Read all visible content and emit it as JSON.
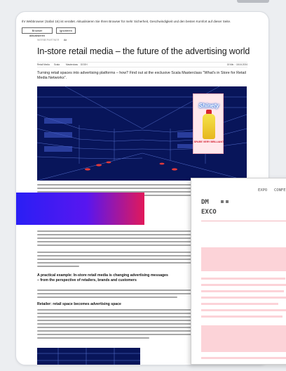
{
  "browser_warning": {
    "text": "Ihr Webbrowser (Safari 16) ist veraltet. Aktualisieren Sie Ihren Browser für mehr Sicherheit, Geschwindigkeit und den besten Komfort auf dieser Seite.",
    "update_button": "Browser aktualisieren",
    "ignore_button": "Ignorieren"
  },
  "article": {
    "category": "WERBEPARTNER",
    "ad_label": "Ad",
    "title": "In-store retail media – the future of the advertising world",
    "tags": [
      "Retail Media",
      "Scala",
      "Masterclass",
      "DOOH"
    ],
    "reading_time": "15 Min. · 18.04.2024",
    "lead": "Turning retail spaces into advertising platforms – how? Find out at the exclusive Scala Masterclass \"What's in Store for Retail Media Networks\".",
    "section_heading": "A practical example: In-store retail media is changing advertising messages – from the perspective of retailers, brands and customers",
    "subsection_heading": "Retailer: retail space becomes advertising space"
  },
  "hero_ad": {
    "brand": "Shinety",
    "offer": "SPARE VERY BRILLIANT"
  },
  "overlay": {
    "nav": [
      "EXPO",
      "CONFE"
    ],
    "logo_line1": "DM",
    "logo_line2": "EXCO"
  },
  "colors": {
    "navy": "#08155a",
    "promo_start": "#2a1ff5",
    "promo_end": "#e1185a",
    "overlay_pink": "#fcd3d8"
  }
}
